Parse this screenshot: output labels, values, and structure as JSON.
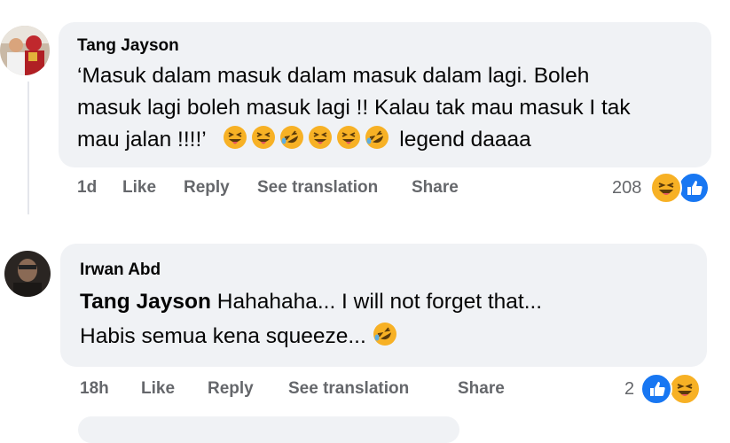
{
  "comments": [
    {
      "author": "Tang Jayson",
      "lines": [
        "‘Masuk dalam masuk dalam masuk dalam lagi. Boleh",
        "masuk lagi boleh masuk lagi !! Kalau tak mau masuk I tak",
        "mau jalan !!!!’"
      ],
      "line3_suffix": "legend daaaa",
      "emojis": [
        "squint-tongue-emoji",
        "squint-tongue-emoji",
        "rolling-laugh-emoji",
        "squint-tongue-emoji",
        "squint-tongue-emoji",
        "rolling-laugh-emoji"
      ],
      "time": "1d",
      "like": "Like",
      "reply": "Reply",
      "translate": "See translation",
      "share": "Share",
      "reaction_count": "208",
      "reactions": [
        "haha-icon",
        "like-icon"
      ]
    },
    {
      "author": "Irwan Abd",
      "mention": "Tang Jayson",
      "line1": " Hahahaha... I will not forget that...",
      "line2": "Habis semua kena squeeze...",
      "emojis": [
        "rolling-laugh-emoji"
      ],
      "time": "18h",
      "like": "Like",
      "reply": "Reply",
      "translate": "See translation",
      "share": "Share",
      "reaction_count": "2",
      "reactions": [
        "like-icon",
        "haha-icon"
      ]
    }
  ],
  "colors": {
    "bubble": "#f0f2f5",
    "meta": "#65676b",
    "like_blue": "#1877f2",
    "haha_yellow": "#f7b125"
  }
}
